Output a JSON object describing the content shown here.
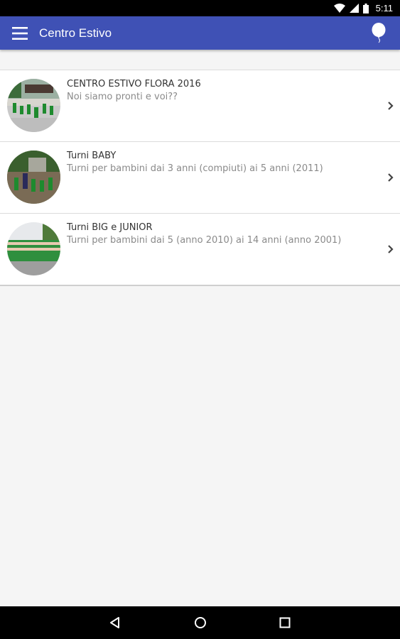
{
  "status": {
    "time": "5:11",
    "icons": [
      "wifi-icon",
      "signal-icon",
      "battery-icon"
    ]
  },
  "appbar": {
    "title": "Centro Estivo",
    "menu_icon": "hamburger-icon",
    "action_icon": "balloon-icon",
    "color": "#3f51b5"
  },
  "items": [
    {
      "title": "CENTRO ESTIVO FLORA 2016",
      "subtitle": "Noi siamo pronti e voi??"
    },
    {
      "title": "Turni BABY",
      "subtitle": "Turni per bambini dai 3 anni (compiuti) ai 5 anni (2011)"
    },
    {
      "title": "Turni BIG e JUNIOR",
      "subtitle": "Turni per bambini dai 5 (anno 2010) ai 14 anni (anno 2001)"
    }
  ],
  "navbar": {
    "icons": [
      "back-icon",
      "home-icon",
      "recents-icon"
    ]
  }
}
